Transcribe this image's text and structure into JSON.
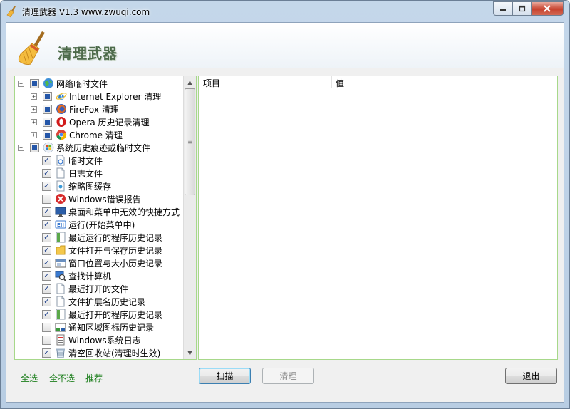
{
  "window": {
    "title": "清理武器 V1.3 www.zwuqi.com",
    "min_label": "▭",
    "max_label": "□",
    "close_label": "✕"
  },
  "banner": {
    "title": "清理武器"
  },
  "tree": {
    "items": [
      {
        "label": "网络临时文件",
        "level": 0,
        "expander": "−",
        "check": "partial",
        "icon": "globe-icon"
      },
      {
        "label": "Internet Explorer 清理",
        "level": 1,
        "expander": "+",
        "check": "partial",
        "icon": "ie-icon"
      },
      {
        "label": "FireFox 清理",
        "level": 1,
        "expander": "+",
        "check": "partial",
        "icon": "firefox-icon"
      },
      {
        "label": "Opera 历史记录清理",
        "level": 1,
        "expander": "+",
        "check": "partial",
        "icon": "opera-icon"
      },
      {
        "label": "Chrome 清理",
        "level": 1,
        "expander": "+",
        "check": "partial",
        "icon": "chrome-icon"
      },
      {
        "label": "系统历史痕迹或临时文件",
        "level": 0,
        "expander": "−",
        "check": "partial",
        "icon": "windows-icon"
      },
      {
        "label": "临时文件",
        "level": 2,
        "check": "checked",
        "icon": "temp-file-icon"
      },
      {
        "label": "日志文件",
        "level": 2,
        "check": "checked",
        "icon": "document-icon"
      },
      {
        "label": "缩略图缓存",
        "level": 2,
        "check": "checked",
        "icon": "thumbnail-icon"
      },
      {
        "label": "Windows错误报告",
        "level": 2,
        "check": "unchecked",
        "icon": "error-icon"
      },
      {
        "label": "桌面和菜单中无效的快捷方式",
        "level": 2,
        "check": "checked",
        "icon": "desktop-icon"
      },
      {
        "label": "运行(开始菜单中)",
        "level": 2,
        "check": "checked",
        "icon": "run-icon"
      },
      {
        "label": "最近运行的程序历史记录",
        "level": 2,
        "check": "checked",
        "icon": "program-icon"
      },
      {
        "label": "文件打开与保存历史记录",
        "level": 2,
        "check": "checked",
        "icon": "folder-icon"
      },
      {
        "label": "窗口位置与大小历史记录",
        "level": 2,
        "check": "checked",
        "icon": "window-icon"
      },
      {
        "label": "查找计算机",
        "level": 2,
        "check": "checked",
        "icon": "search-computer-icon"
      },
      {
        "label": "最近打开的文件",
        "level": 2,
        "check": "checked",
        "icon": "document-icon"
      },
      {
        "label": "文件扩展名历史记录",
        "level": 2,
        "check": "checked",
        "icon": "document-icon"
      },
      {
        "label": "最近打开的程序历史记录",
        "level": 2,
        "check": "checked",
        "icon": "program-icon"
      },
      {
        "label": "通知区域图标历史记录",
        "level": 2,
        "check": "unchecked",
        "icon": "tray-icon"
      },
      {
        "label": "Windows系统日志",
        "level": 2,
        "check": "unchecked",
        "icon": "syslog-icon"
      },
      {
        "label": "清空回收站(清理时生效)",
        "level": 2,
        "check": "checked",
        "icon": "recycle-bin-icon"
      }
    ]
  },
  "list": {
    "columns": [
      "项目",
      "值"
    ]
  },
  "footer": {
    "select_all": "全选",
    "select_none": "全不选",
    "recommend": "推荐",
    "scan": "扫描",
    "clean": "清理",
    "exit": "退出"
  },
  "colors": {
    "panel_border": "#a7d88a",
    "link": "#1d7f1d",
    "title_green": "#4c6a4a"
  }
}
